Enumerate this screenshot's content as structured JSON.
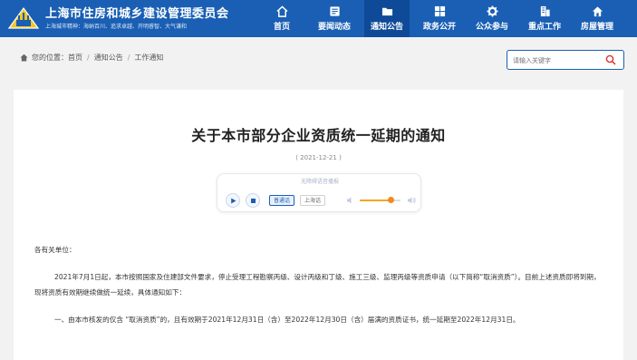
{
  "header": {
    "org_name": "上海市住房和城乡建设管理委员会",
    "motto": "上海城市精神：海纳百川、追求卓越、开明睿智、大气谦和",
    "brand_color": "#1a5fb4"
  },
  "nav": {
    "items": [
      {
        "label": "首页",
        "icon": "home-icon"
      },
      {
        "label": "要闻动态",
        "icon": "news-icon"
      },
      {
        "label": "通知公告",
        "icon": "folder-icon",
        "active": true
      },
      {
        "label": "政务公开",
        "icon": "grid-icon"
      },
      {
        "label": "公众参与",
        "icon": "gear-icon"
      },
      {
        "label": "重点工作",
        "icon": "building-icon"
      },
      {
        "label": "房屋管理",
        "icon": "house-icon"
      }
    ]
  },
  "breadcrumb": {
    "prefix": "您的位置：",
    "items": [
      "首页",
      "通知公告",
      "工作通知"
    ]
  },
  "search": {
    "placeholder": "请输入关键字"
  },
  "article": {
    "title": "关于本市部分企业资质统一延期的通知",
    "date": "( 2021-12-21 )",
    "paragraphs": [
      "各有关单位：",
      "2021年7月1日起，本市按照国家及住建部文件要求，停止受理工程勘察丙级、设计丙级和丁级、施工三级、监理丙级等资质申请（以下简称“取消资质”）。目前上述资质即将到期，现将资质有效期继续做统一延续，具体通知如下：",
      "一、由本市核发的仅含 “取消资质”的，且有效期于2021年12月31日（含）至2022年12月30日（含）届满的资质证书，统一延期至2022年12月31日。"
    ]
  },
  "player": {
    "caption": "无障碍语音播报",
    "lang_mandarin": "普通话",
    "lang_shanghai": "上海话",
    "volume": 0.75
  }
}
